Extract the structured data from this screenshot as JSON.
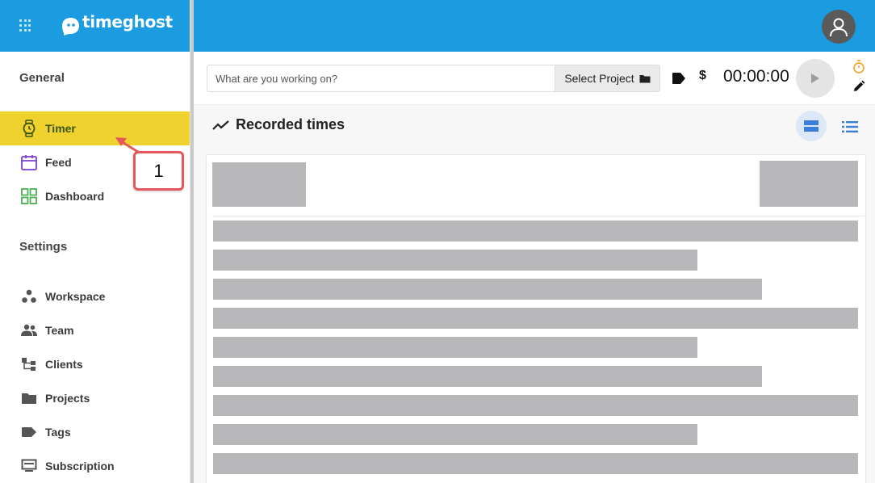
{
  "app": {
    "logo_text": "timeghost"
  },
  "sidebar": {
    "general_title": "General",
    "general_items": [
      {
        "label": "Timer",
        "icon": "watch-icon",
        "active": true
      },
      {
        "label": "Feed",
        "icon": "calendar-icon"
      },
      {
        "label": "Dashboard",
        "icon": "grid-icon"
      }
    ],
    "settings_title": "Settings",
    "settings_items": [
      {
        "label": "Workspace",
        "icon": "workspace-icon"
      },
      {
        "label": "Team",
        "icon": "team-icon"
      },
      {
        "label": "Clients",
        "icon": "clients-icon"
      },
      {
        "label": "Projects",
        "icon": "folder-icon"
      },
      {
        "label": "Tags",
        "icon": "tag-icon"
      },
      {
        "label": "Subscription",
        "icon": "subscription-icon"
      }
    ]
  },
  "timer": {
    "placeholder": "What are you working on?",
    "project_label": "Select Project",
    "billable_symbol": "$",
    "time": "00:00:00"
  },
  "recorded": {
    "title": "Recorded times"
  },
  "annotation": {
    "label": "1"
  },
  "colors": {
    "brand_blue": "#1b9be0",
    "active_yellow": "#f0d22e",
    "annotation_red": "#e4575a"
  }
}
